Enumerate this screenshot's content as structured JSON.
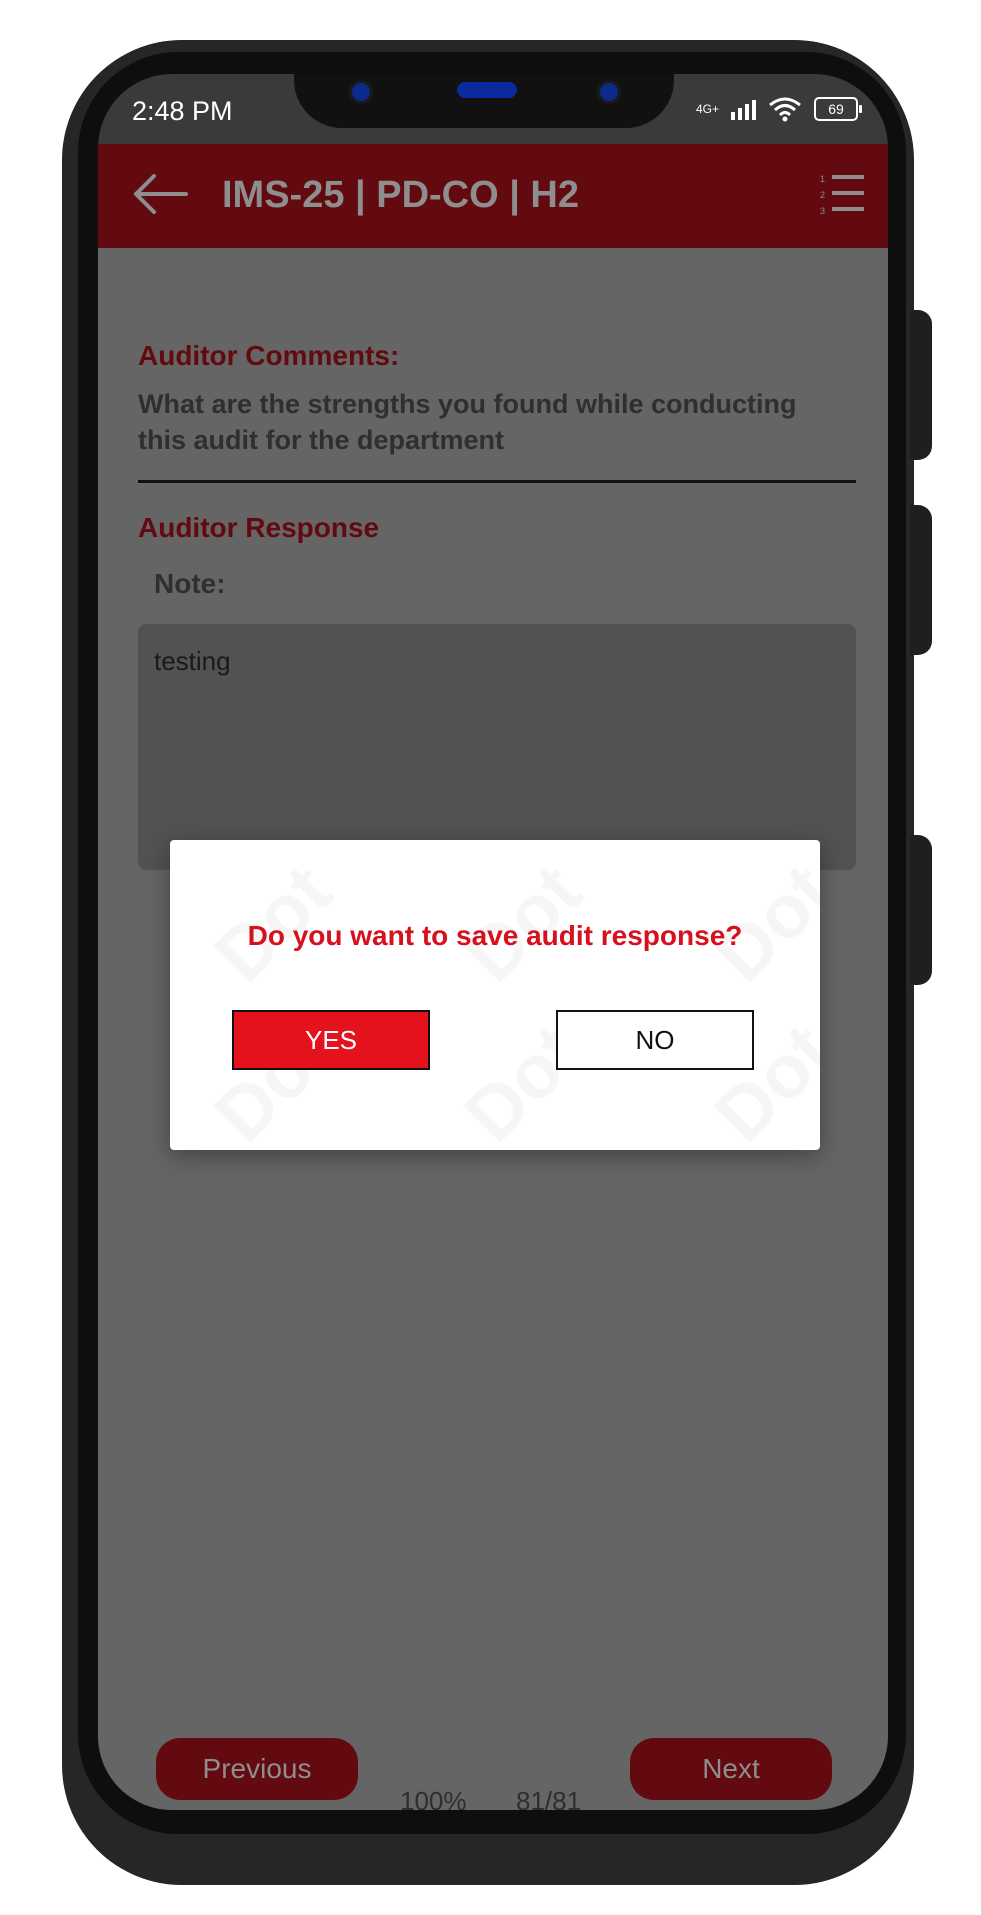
{
  "status_bar": {
    "time": "2:48 PM",
    "network": "4G+",
    "battery": "69"
  },
  "header": {
    "title": "IMS-25 | PD-CO | H2",
    "back_icon": "arrow-left-icon",
    "menu_icon": "numbered-list-icon"
  },
  "form": {
    "comments_title": "Auditor Comments:",
    "question": "What are the strengths you found while conducting this audit for the department",
    "response_title": "Auditor Response",
    "note_label": "Note:",
    "note_value": "testing"
  },
  "dialog": {
    "message": "Do you want to save audit response?",
    "yes_label": "YES",
    "no_label": "NO"
  },
  "footer": {
    "previous_label": "Previous",
    "next_label": "Next",
    "progress_percent": "100%",
    "page_counter": "81/81"
  },
  "colors": {
    "header": "#620a0f",
    "accent_red": "#e3121c",
    "dialog_message": "#d6101d",
    "overlay_background": "#656565"
  }
}
